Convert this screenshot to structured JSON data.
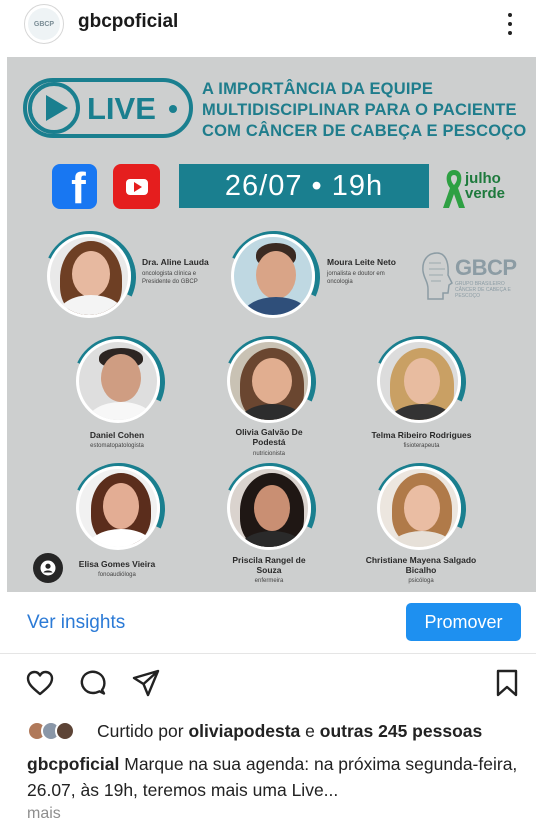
{
  "header": {
    "avatar_text": "GBCP",
    "username": "gbcpoficial"
  },
  "post": {
    "live_label": "LIVE",
    "headline": "A IMPORTÂNCIA DA EQUIPE MULTIDISCIPLINAR PARA O PACIENTE COM CÂNCER DE CABEÇA E PESCOÇO",
    "date_time": "26/07 • 19h",
    "julho": "julho",
    "verde": "verde",
    "logo_text": "GBCP",
    "logo_sub": "GRUPO BRASILEIRO CÂNCER DE CABEÇA E PESCOÇO",
    "speakers": [
      {
        "name": "Dra. Aline Lauda",
        "role": "oncologista clínica e Presidente do GBCP"
      },
      {
        "name": "Moura Leite Neto",
        "role": "jornalista e doutor em oncologia"
      },
      {
        "name": "Daniel Cohen",
        "role": "estomatopatologista"
      },
      {
        "name": "Olivia Galvão De Podestá",
        "role": "nutricionista"
      },
      {
        "name": "Telma Ribeiro Rodrigues",
        "role": "fisioterapeuta"
      },
      {
        "name": "Elisa Gomes Vieira",
        "role": "fonoaudióloga"
      },
      {
        "name": "Priscila Rangel de Souza",
        "role": "enfermeira"
      },
      {
        "name": "Christiane Mayena Salgado Bicalho",
        "role": "psicóloga"
      }
    ]
  },
  "insights": {
    "link": "Ver insights",
    "promote": "Promover"
  },
  "likes": {
    "prefix": "Curtido por",
    "user": "oliviapodesta",
    "connector": "e",
    "others": "outras 245 pessoas"
  },
  "caption": {
    "user": "gbcpoficial",
    "text": "Marque na sua agenda: na próxima segunda-feira, 26.07, às 19h, teremos mais uma Live...",
    "more": "mais"
  },
  "colors": {
    "teal": "#1a7f8f",
    "link_blue": "#2b7ad6",
    "button_blue": "#1e90f0"
  }
}
